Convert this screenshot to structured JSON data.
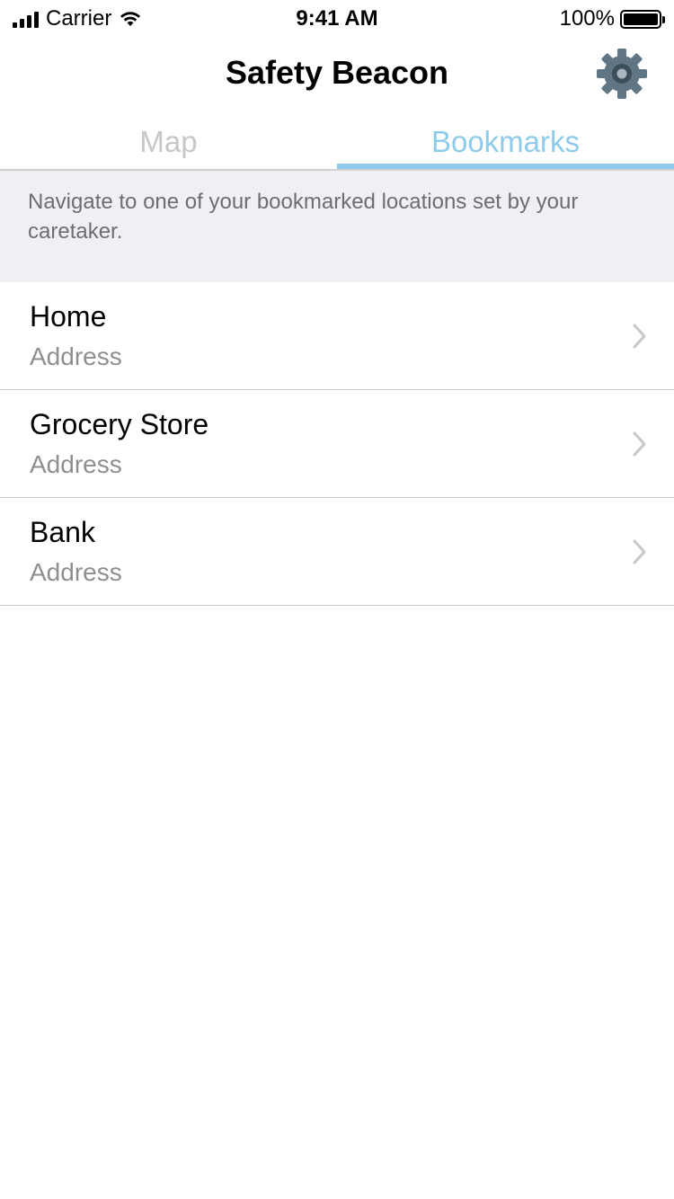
{
  "status_bar": {
    "carrier": "Carrier",
    "time": "9:41 AM",
    "battery": "100%"
  },
  "nav": {
    "title": "Safety Beacon",
    "settings_icon": "gear-icon"
  },
  "tabs": [
    {
      "label": "Map",
      "active": false
    },
    {
      "label": "Bookmarks",
      "active": true
    }
  ],
  "description": "Navigate to one of your bookmarked locations set by your caretaker.",
  "bookmarks": [
    {
      "name": "Home",
      "address": "Address"
    },
    {
      "name": "Grocery Store",
      "address": "Address"
    },
    {
      "name": "Bank",
      "address": "Address"
    }
  ],
  "colors": {
    "accent": "#8ecbea",
    "inactive_tab": "#c7c7c7",
    "gear": "#607684",
    "description_bg": "#efeff4"
  }
}
